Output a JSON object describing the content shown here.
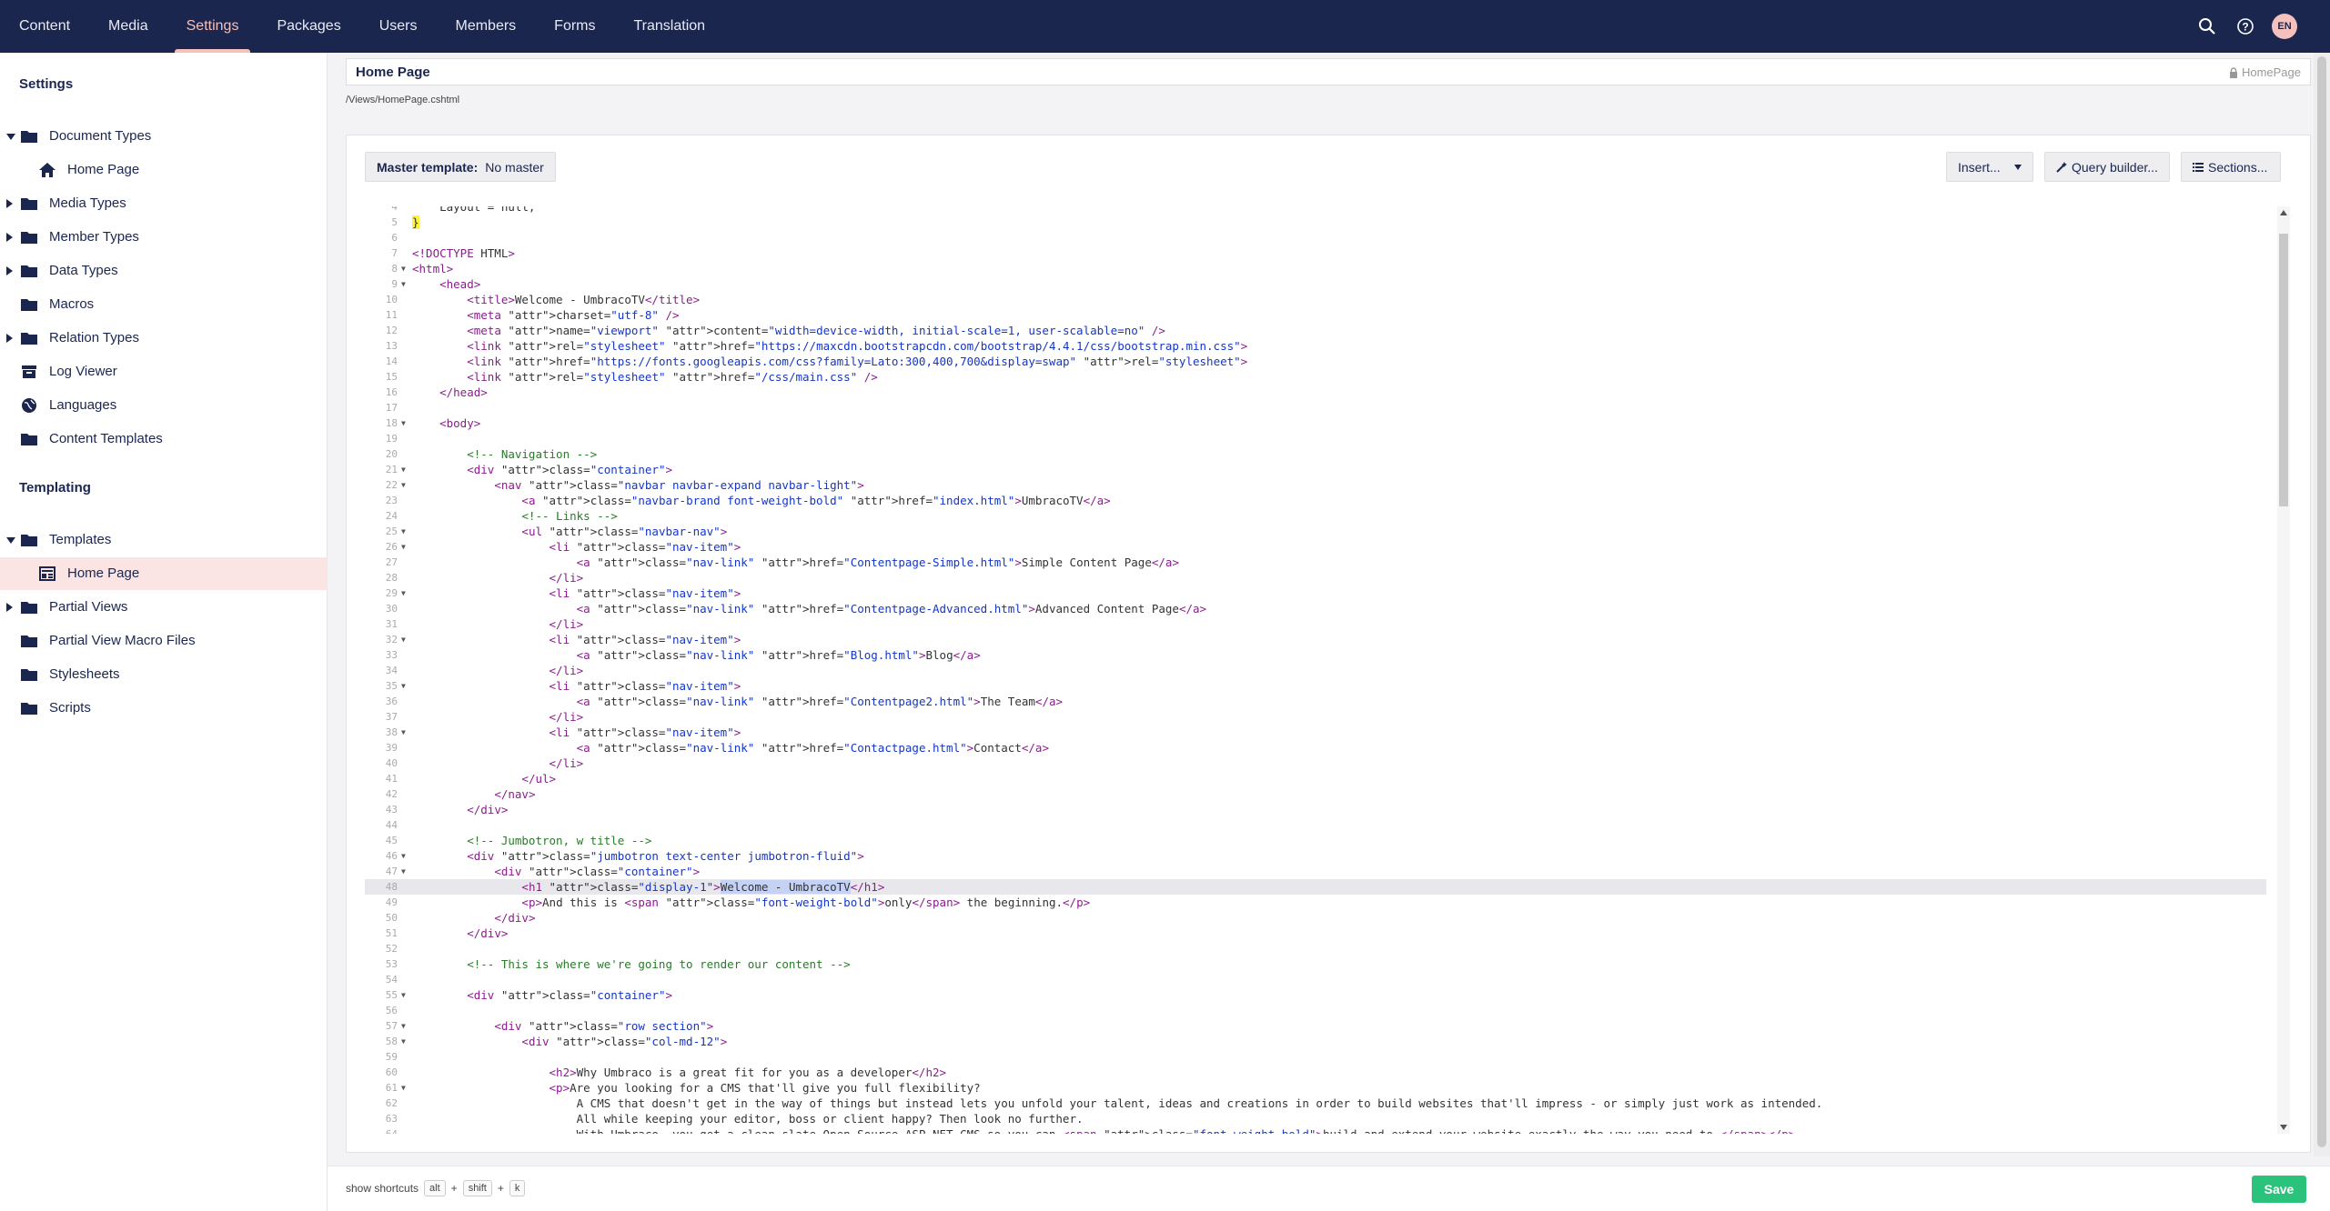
{
  "topnav": {
    "items": [
      {
        "label": "Content"
      },
      {
        "label": "Media"
      },
      {
        "label": "Settings"
      },
      {
        "label": "Packages"
      },
      {
        "label": "Users"
      },
      {
        "label": "Members"
      },
      {
        "label": "Forms"
      },
      {
        "label": "Translation"
      }
    ],
    "active": "Settings",
    "avatar_initials": "EN"
  },
  "sidebar": {
    "section_settings": "Settings",
    "section_templating": "Templating",
    "items": [
      {
        "label": "Document Types"
      },
      {
        "label": "Home Page"
      },
      {
        "label": "Media Types"
      },
      {
        "label": "Member Types"
      },
      {
        "label": "Data Types"
      },
      {
        "label": "Macros"
      },
      {
        "label": "Relation Types"
      },
      {
        "label": "Log Viewer"
      },
      {
        "label": "Languages"
      },
      {
        "label": "Content Templates"
      },
      {
        "label": "Templates"
      },
      {
        "label": "Home Page"
      },
      {
        "label": "Partial Views"
      },
      {
        "label": "Partial View Macro Files"
      },
      {
        "label": "Stylesheets"
      },
      {
        "label": "Scripts"
      }
    ]
  },
  "header": {
    "name": "Home Page",
    "alias": "HomePage",
    "path": "/Views/HomePage.cshtml"
  },
  "toolbar": {
    "master_label": "Master template:",
    "master_value": "No master",
    "insert": "Insert...",
    "query_builder": "Query builder...",
    "sections": "Sections..."
  },
  "code": {
    "lines": [
      {
        "n": "4",
        "t": "    Layout = null;"
      },
      {
        "n": "5",
        "t": "}"
      },
      {
        "n": "6",
        "t": ""
      },
      {
        "n": "7",
        "t": "<!DOCTYPE HTML>"
      },
      {
        "n": "8",
        "t": "<html>"
      },
      {
        "n": "9",
        "t": "    <head>"
      },
      {
        "n": "10",
        "t": "        <title>Welcome - UmbracoTV</title>"
      },
      {
        "n": "11",
        "t": "        <meta charset=\"utf-8\" />"
      },
      {
        "n": "12",
        "t": "        <meta name=\"viewport\" content=\"width=device-width, initial-scale=1, user-scalable=no\" />"
      },
      {
        "n": "13",
        "t": "        <link rel=\"stylesheet\" href=\"https://maxcdn.bootstrapcdn.com/bootstrap/4.4.1/css/bootstrap.min.css\">"
      },
      {
        "n": "14",
        "t": "        <link href=\"https://fonts.googleapis.com/css?family=Lato:300,400,700&display=swap\" rel=\"stylesheet\">"
      },
      {
        "n": "15",
        "t": "        <link rel=\"stylesheet\" href=\"/css/main.css\" />"
      },
      {
        "n": "16",
        "t": "    </head>"
      },
      {
        "n": "17",
        "t": ""
      },
      {
        "n": "18",
        "t": "    <body>"
      },
      {
        "n": "19",
        "t": ""
      },
      {
        "n": "20",
        "t": "        <!-- Navigation -->"
      },
      {
        "n": "21",
        "t": "        <div class=\"container\">"
      },
      {
        "n": "22",
        "t": "            <nav class=\"navbar navbar-expand navbar-light\">"
      },
      {
        "n": "23",
        "t": "                <a class=\"navbar-brand font-weight-bold\" href=\"index.html\">UmbracoTV</a>"
      },
      {
        "n": "24",
        "t": "                <!-- Links -->"
      },
      {
        "n": "25",
        "t": "                <ul class=\"navbar-nav\">"
      },
      {
        "n": "26",
        "t": "                    <li class=\"nav-item\">"
      },
      {
        "n": "27",
        "t": "                        <a class=\"nav-link\" href=\"Contentpage-Simple.html\">Simple Content Page</a>"
      },
      {
        "n": "28",
        "t": "                    </li>"
      },
      {
        "n": "29",
        "t": "                    <li class=\"nav-item\">"
      },
      {
        "n": "30",
        "t": "                        <a class=\"nav-link\" href=\"Contentpage-Advanced.html\">Advanced Content Page</a>"
      },
      {
        "n": "31",
        "t": "                    </li>"
      },
      {
        "n": "32",
        "t": "                    <li class=\"nav-item\">"
      },
      {
        "n": "33",
        "t": "                        <a class=\"nav-link\" href=\"Blog.html\">Blog</a>"
      },
      {
        "n": "34",
        "t": "                    </li>"
      },
      {
        "n": "35",
        "t": "                    <li class=\"nav-item\">"
      },
      {
        "n": "36",
        "t": "                        <a class=\"nav-link\" href=\"Contentpage2.html\">The Team</a>"
      },
      {
        "n": "37",
        "t": "                    </li>"
      },
      {
        "n": "38",
        "t": "                    <li class=\"nav-item\">"
      },
      {
        "n": "39",
        "t": "                        <a class=\"nav-link\" href=\"Contactpage.html\">Contact</a>"
      },
      {
        "n": "40",
        "t": "                    </li>"
      },
      {
        "n": "41",
        "t": "                </ul>"
      },
      {
        "n": "42",
        "t": "            </nav>"
      },
      {
        "n": "43",
        "t": "        </div>"
      },
      {
        "n": "44",
        "t": ""
      },
      {
        "n": "45",
        "t": "        <!-- Jumbotron, w title -->"
      },
      {
        "n": "46",
        "t": "        <div class=\"jumbotron text-center jumbotron-fluid\">"
      },
      {
        "n": "47",
        "t": "            <div class=\"container\">"
      },
      {
        "n": "48",
        "t": "                <h1 class=\"display-1\">Welcome - UmbracoTV</h1>"
      },
      {
        "n": "49",
        "t": "                <p>And this is <span class=\"font-weight-bold\">only</span> the beginning.</p>"
      },
      {
        "n": "50",
        "t": "            </div>"
      },
      {
        "n": "51",
        "t": "        </div>"
      },
      {
        "n": "52",
        "t": ""
      },
      {
        "n": "53",
        "t": "        <!-- This is where we're going to render our content -->"
      },
      {
        "n": "54",
        "t": ""
      },
      {
        "n": "55",
        "t": "        <div class=\"container\">"
      },
      {
        "n": "56",
        "t": ""
      },
      {
        "n": "57",
        "t": "            <div class=\"row section\">"
      },
      {
        "n": "58",
        "t": "                <div class=\"col-md-12\">"
      },
      {
        "n": "59",
        "t": ""
      },
      {
        "n": "60",
        "t": "                    <h2>Why Umbraco is a great fit for you as a developer</h2>"
      },
      {
        "n": "61",
        "t": "                    <p>Are you looking for a CMS that'll give you full flexibility?"
      },
      {
        "n": "62",
        "t": "                        A CMS that doesn't get in the way of things but instead lets you unfold your talent, ideas and creations in order to build websites that'll impress - or simply just work as intended."
      },
      {
        "n": "63",
        "t": "                        All while keeping your editor, boss or client happy? Then look no further."
      },
      {
        "n": "64",
        "t": "                        With Umbraco, you get a clean slate Open Source ASP.NET CMS so you can <span class=\"font-weight-bold\">build and extend your website exactly the way you need to.</span></p>"
      }
    ]
  },
  "footer": {
    "shortcuts_label": "show shortcuts",
    "key1": "alt",
    "plus1": "+",
    "key2": "shift",
    "plus2": "+",
    "key3": "k",
    "save": "Save"
  }
}
